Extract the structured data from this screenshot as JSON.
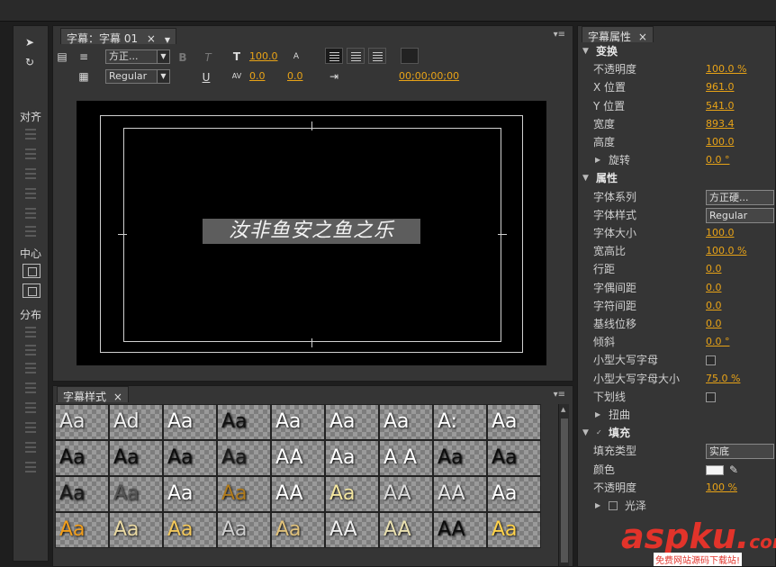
{
  "tools_panel": {
    "sections": [
      {
        "label": "对齐"
      },
      {
        "label": "中心"
      },
      {
        "label": "分布"
      }
    ]
  },
  "title_panel": {
    "tab_label": "字幕：字幕 01",
    "font_family": "方正...",
    "font_style": "Regular",
    "font_size": "100.0",
    "kerning": "0.0",
    "baseline": "0.0",
    "timecode": "00;00;00;00",
    "caption_text": "汝非鱼安之鱼之乐"
  },
  "styles_panel": {
    "tab_label": "字幕样式",
    "swatches": [
      {
        "text": "Aa",
        "color": "#e8e8e8"
      },
      {
        "text": "Ad",
        "color": "#f0f0f0"
      },
      {
        "text": "Aa",
        "color": "#ffffff"
      },
      {
        "text": "Aa",
        "color": "#111111"
      },
      {
        "text": "Aa",
        "color": "#ffffff"
      },
      {
        "text": "Aa",
        "color": "#ffffff"
      },
      {
        "text": "Aa",
        "color": "#ffffff"
      },
      {
        "text": "A:",
        "color": "#ffffff"
      },
      {
        "text": "Aa",
        "color": "#ffffff"
      },
      {
        "text": "Aa",
        "color": "#0d0d0d"
      },
      {
        "text": "Aa",
        "color": "#0d0d0d"
      },
      {
        "text": "Aa",
        "color": "#0d0d0d"
      },
      {
        "text": "Aa",
        "color": "#1a1a1a"
      },
      {
        "text": "AA",
        "color": "#ffffff"
      },
      {
        "text": "Aa",
        "color": "#ffffff"
      },
      {
        "text": "A A",
        "color": "#ffffff"
      },
      {
        "text": "Aa",
        "color": "#0d0d0d"
      },
      {
        "text": "Aa",
        "color": "#0d0d0d"
      },
      {
        "text": "Aa",
        "color": "#1a1a1a"
      },
      {
        "text": "Aa",
        "color": "#555555"
      },
      {
        "text": "Aa",
        "color": "#ffffff"
      },
      {
        "text": "Aa",
        "color": "#b07b1c"
      },
      {
        "text": "AA",
        "color": "#ffffff"
      },
      {
        "text": "Aa",
        "color": "#f3e6a0"
      },
      {
        "text": "AA",
        "color": "#dcdcdc"
      },
      {
        "text": "AA",
        "color": "#e5e5e5"
      },
      {
        "text": "Aa",
        "color": "#ffffff"
      },
      {
        "text": "Aa",
        "color": "#f29e1b"
      },
      {
        "text": "Aa",
        "color": "#e9d9a2"
      },
      {
        "text": "Aa",
        "color": "#f2c75a"
      },
      {
        "text": "Aa",
        "color": "#cfcfcf"
      },
      {
        "text": "Aa",
        "color": "#e0c17a"
      },
      {
        "text": "AA",
        "color": "#efefef"
      },
      {
        "text": "AA",
        "color": "#e9e0b0"
      },
      {
        "text": "AA",
        "color": "#0d0d0d"
      },
      {
        "text": "Aa",
        "color": "#ffd24a"
      }
    ]
  },
  "props_panel": {
    "tab_label": "字幕属性",
    "rows": [
      {
        "kind": "header",
        "label": "变换"
      },
      {
        "kind": "value",
        "label": "不透明度",
        "value": "100.0 %"
      },
      {
        "kind": "value",
        "label": "X 位置",
        "value": "961.0"
      },
      {
        "kind": "value",
        "label": "Y 位置",
        "value": "541.0"
      },
      {
        "kind": "value",
        "label": "宽度",
        "value": "893.4"
      },
      {
        "kind": "value",
        "label": "高度",
        "value": "100.0"
      },
      {
        "kind": "subvalue",
        "label": "旋转",
        "value": "0.0 °"
      },
      {
        "kind": "header",
        "label": "属性"
      },
      {
        "kind": "dropdown",
        "label": "字体系列",
        "value": "方正硬..."
      },
      {
        "kind": "dropdown",
        "label": "字体样式",
        "value": "Regular"
      },
      {
        "kind": "value",
        "label": "字体大小",
        "value": "100.0"
      },
      {
        "kind": "value",
        "label": "宽高比",
        "value": "100.0 %"
      },
      {
        "kind": "value",
        "label": "行距",
        "value": "0.0"
      },
      {
        "kind": "value",
        "label": "字偶间距",
        "value": "0.0"
      },
      {
        "kind": "value",
        "label": "字符间距",
        "value": "0.0"
      },
      {
        "kind": "value",
        "label": "基线位移",
        "value": "0.0"
      },
      {
        "kind": "value",
        "label": "倾斜",
        "value": "0.0 °"
      },
      {
        "kind": "check",
        "label": "小型大写字母"
      },
      {
        "kind": "value",
        "label": "小型大写字母大小",
        "value": "75.0 %"
      },
      {
        "kind": "check",
        "label": "下划线"
      },
      {
        "kind": "subonly",
        "label": "扭曲"
      },
      {
        "kind": "checkheader",
        "label": "填充"
      },
      {
        "kind": "dropdown",
        "label": "填充类型",
        "value": "实底"
      },
      {
        "kind": "color",
        "label": "颜色"
      },
      {
        "kind": "value",
        "label": "不透明度",
        "value": "100 %"
      },
      {
        "kind": "subcheck",
        "label": "光泽"
      }
    ]
  },
  "watermark": {
    "logo": "aspku",
    "dot": ".",
    "tld": "com",
    "sub": "免费网站源码下载站!"
  }
}
